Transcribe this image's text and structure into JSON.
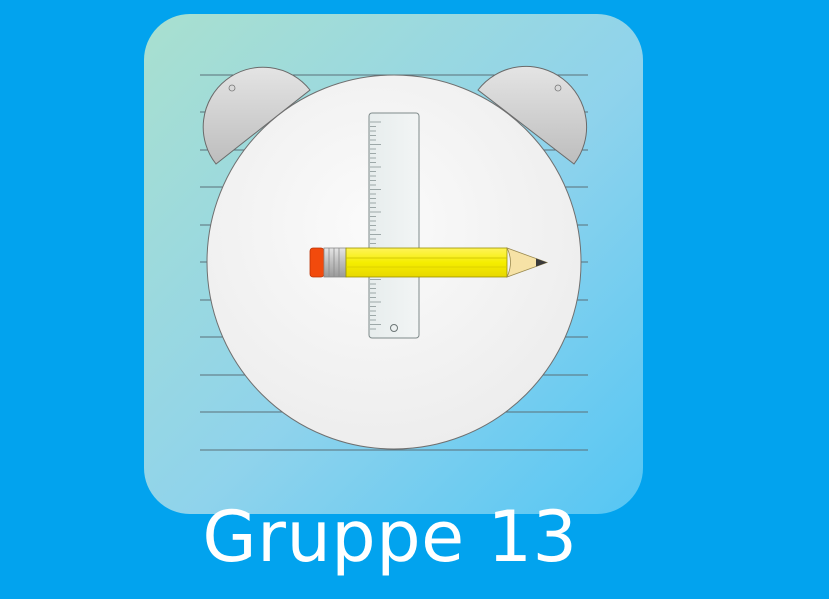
{
  "app": {
    "name": "Gruppe 13",
    "icon": "alarm-clock-ruler-pencil-icon"
  },
  "colors": {
    "background": "#02a3ee",
    "tile_gradient_start": "#a8e0d0",
    "tile_gradient_end": "#5cc8f2",
    "clock_face": "#f3f3f3",
    "bell": "#cfcfcf",
    "pencil_body": "#f7f200",
    "pencil_eraser": "#f04a10",
    "label_text": "#ffffff"
  }
}
